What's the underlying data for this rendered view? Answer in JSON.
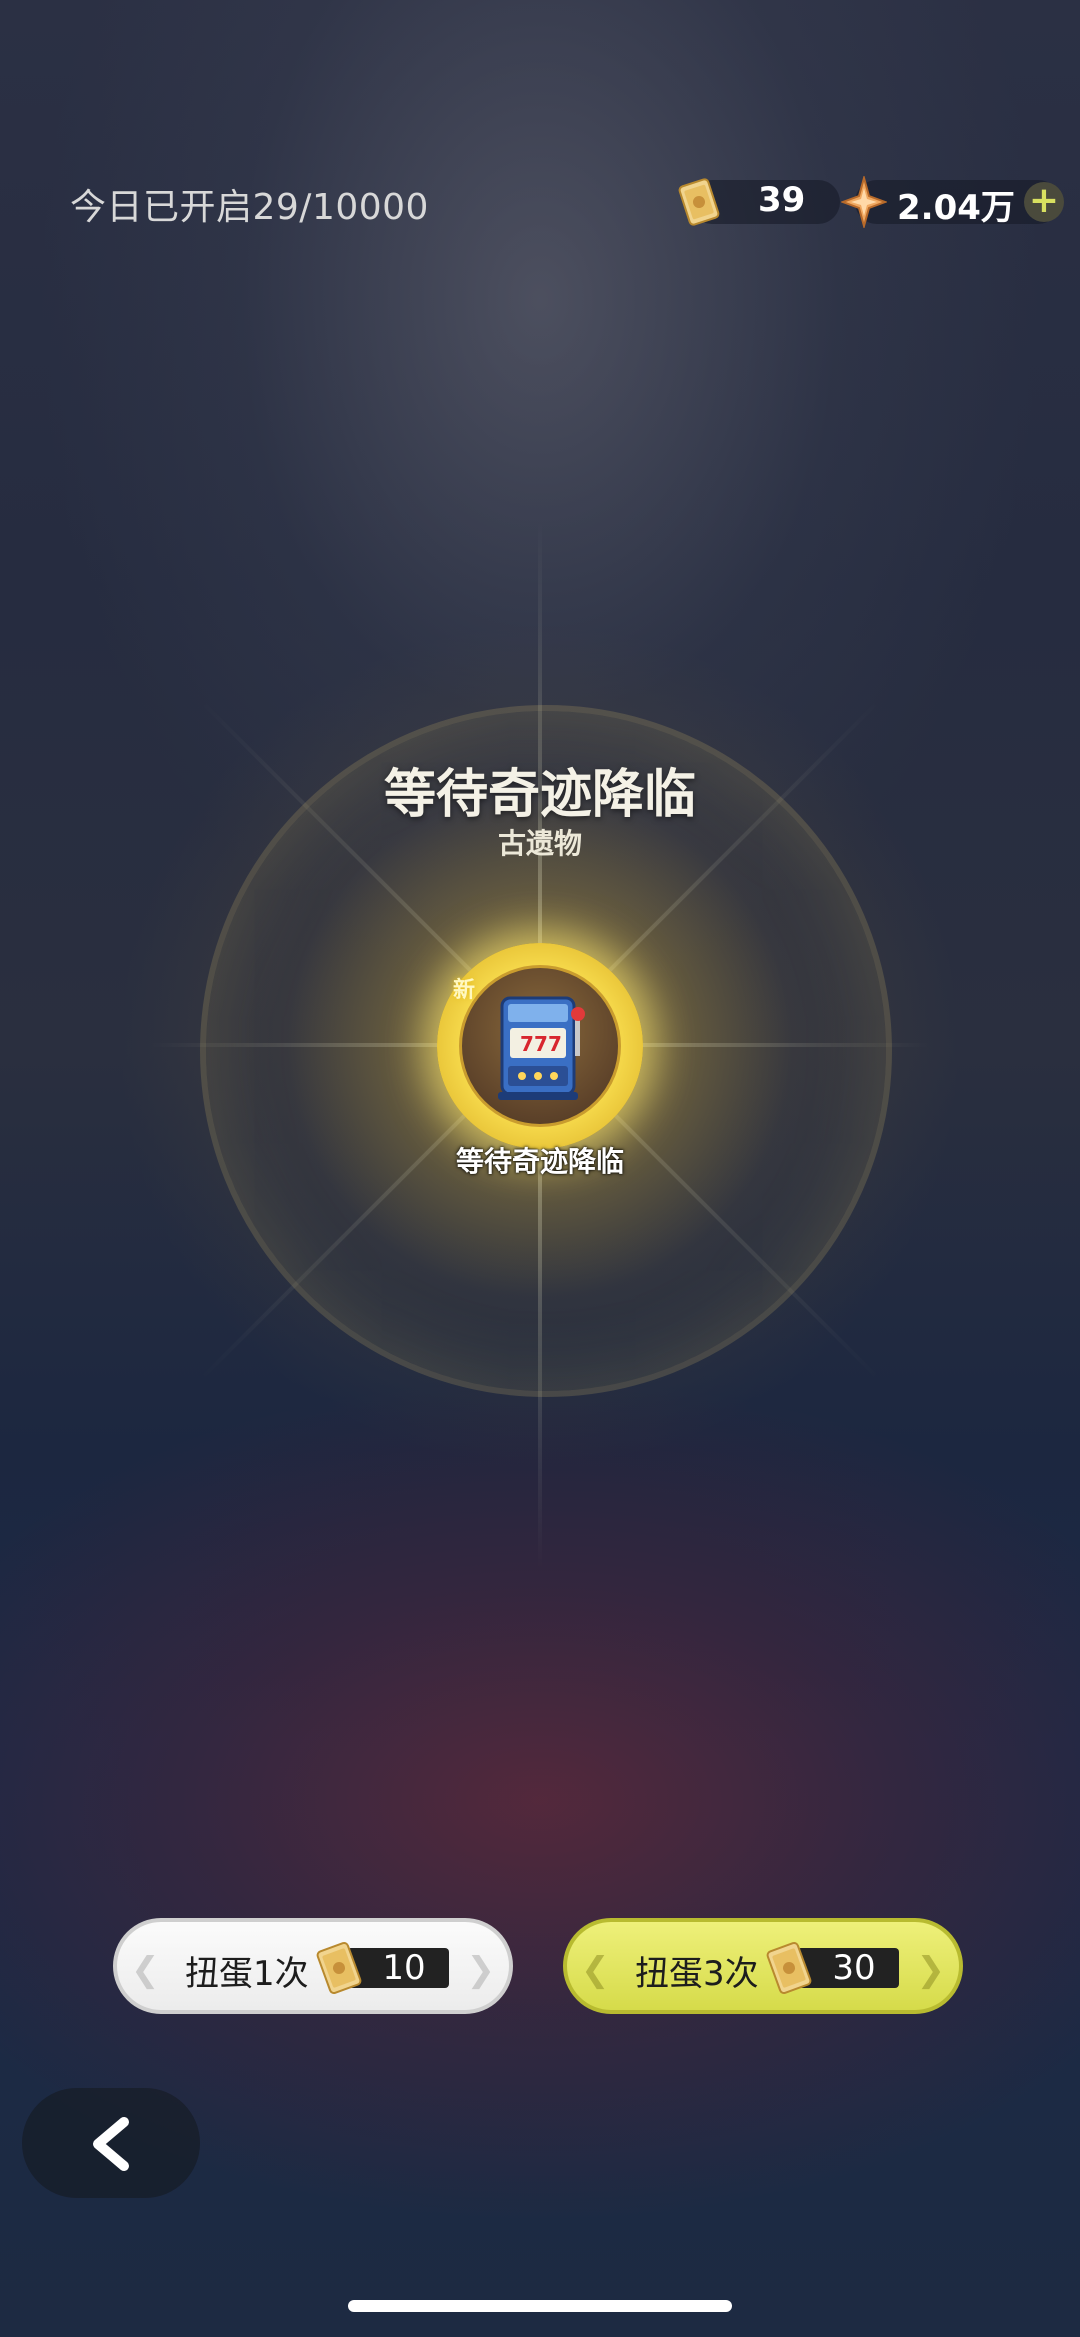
{
  "header": {
    "opened_today": "今日已开启29/10000",
    "ticket_count": "39",
    "gem_count": "2.04万",
    "add_symbol": "+"
  },
  "result": {
    "title": "等待奇迹降临",
    "subtitle": "古遗物",
    "item_name": "等待奇迹降临",
    "new_badge": "新",
    "item_icon": "slot-machine-icon"
  },
  "actions": {
    "pull_one_label": "扭蛋1次",
    "pull_one_cost": "10",
    "pull_three_label": "扭蛋3次",
    "pull_three_cost": "30"
  },
  "colors": {
    "accent_yellow": "#d6db4a",
    "glow_gold": "#f5d84a"
  }
}
